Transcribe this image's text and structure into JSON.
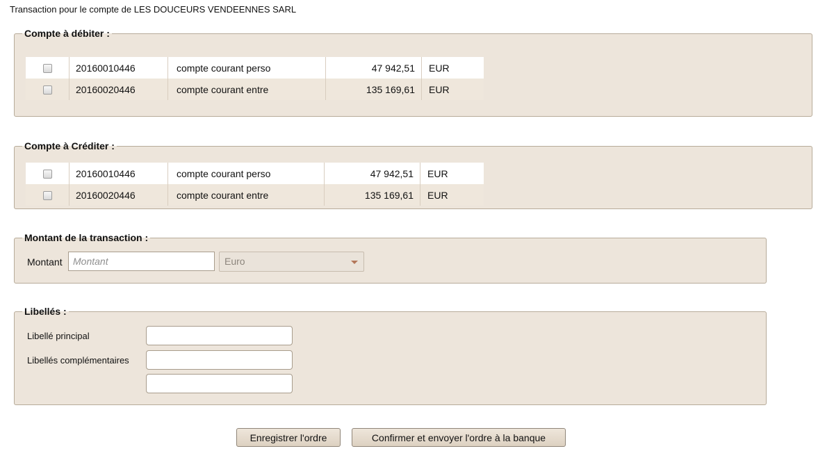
{
  "page": {
    "title": "Transaction pour le compte de LES DOUCEURS VENDEENNES SARL"
  },
  "debit": {
    "legend": "Compte à débiter :",
    "rows": [
      {
        "number": "20160010446",
        "label": "compte courant perso",
        "balance": "47 942,51",
        "currency": "EUR"
      },
      {
        "number": "20160020446",
        "label": "compte courant entre",
        "balance": "135 169,61",
        "currency": "EUR"
      }
    ]
  },
  "credit": {
    "legend": "Compte à Créditer :",
    "rows": [
      {
        "number": "20160010446",
        "label": "compte courant perso",
        "balance": "47 942,51",
        "currency": "EUR"
      },
      {
        "number": "20160020446",
        "label": "compte courant entre",
        "balance": "135 169,61",
        "currency": "EUR"
      }
    ]
  },
  "amount": {
    "legend": "Montant de la transaction :",
    "label": "Montant",
    "placeholder": "Montant",
    "value": "",
    "currency_selected": "Euro"
  },
  "labels": {
    "legend": "Libellés :",
    "main_label": "Libellé principal",
    "extra_label": "Libellés complémentaires",
    "main_value": "",
    "extra_value_1": "",
    "extra_value_2": ""
  },
  "actions": {
    "save_label": "Enregistrer l'ordre",
    "confirm_label": "Confirmer et envoyer l'ordre à la banque"
  },
  "colors": {
    "panel_background": "#ede5db",
    "panel_border": "#b7ab99",
    "alt_row": "#efe7dc",
    "button_background": "#e6ddd0",
    "select_arrow": "#b37759"
  }
}
